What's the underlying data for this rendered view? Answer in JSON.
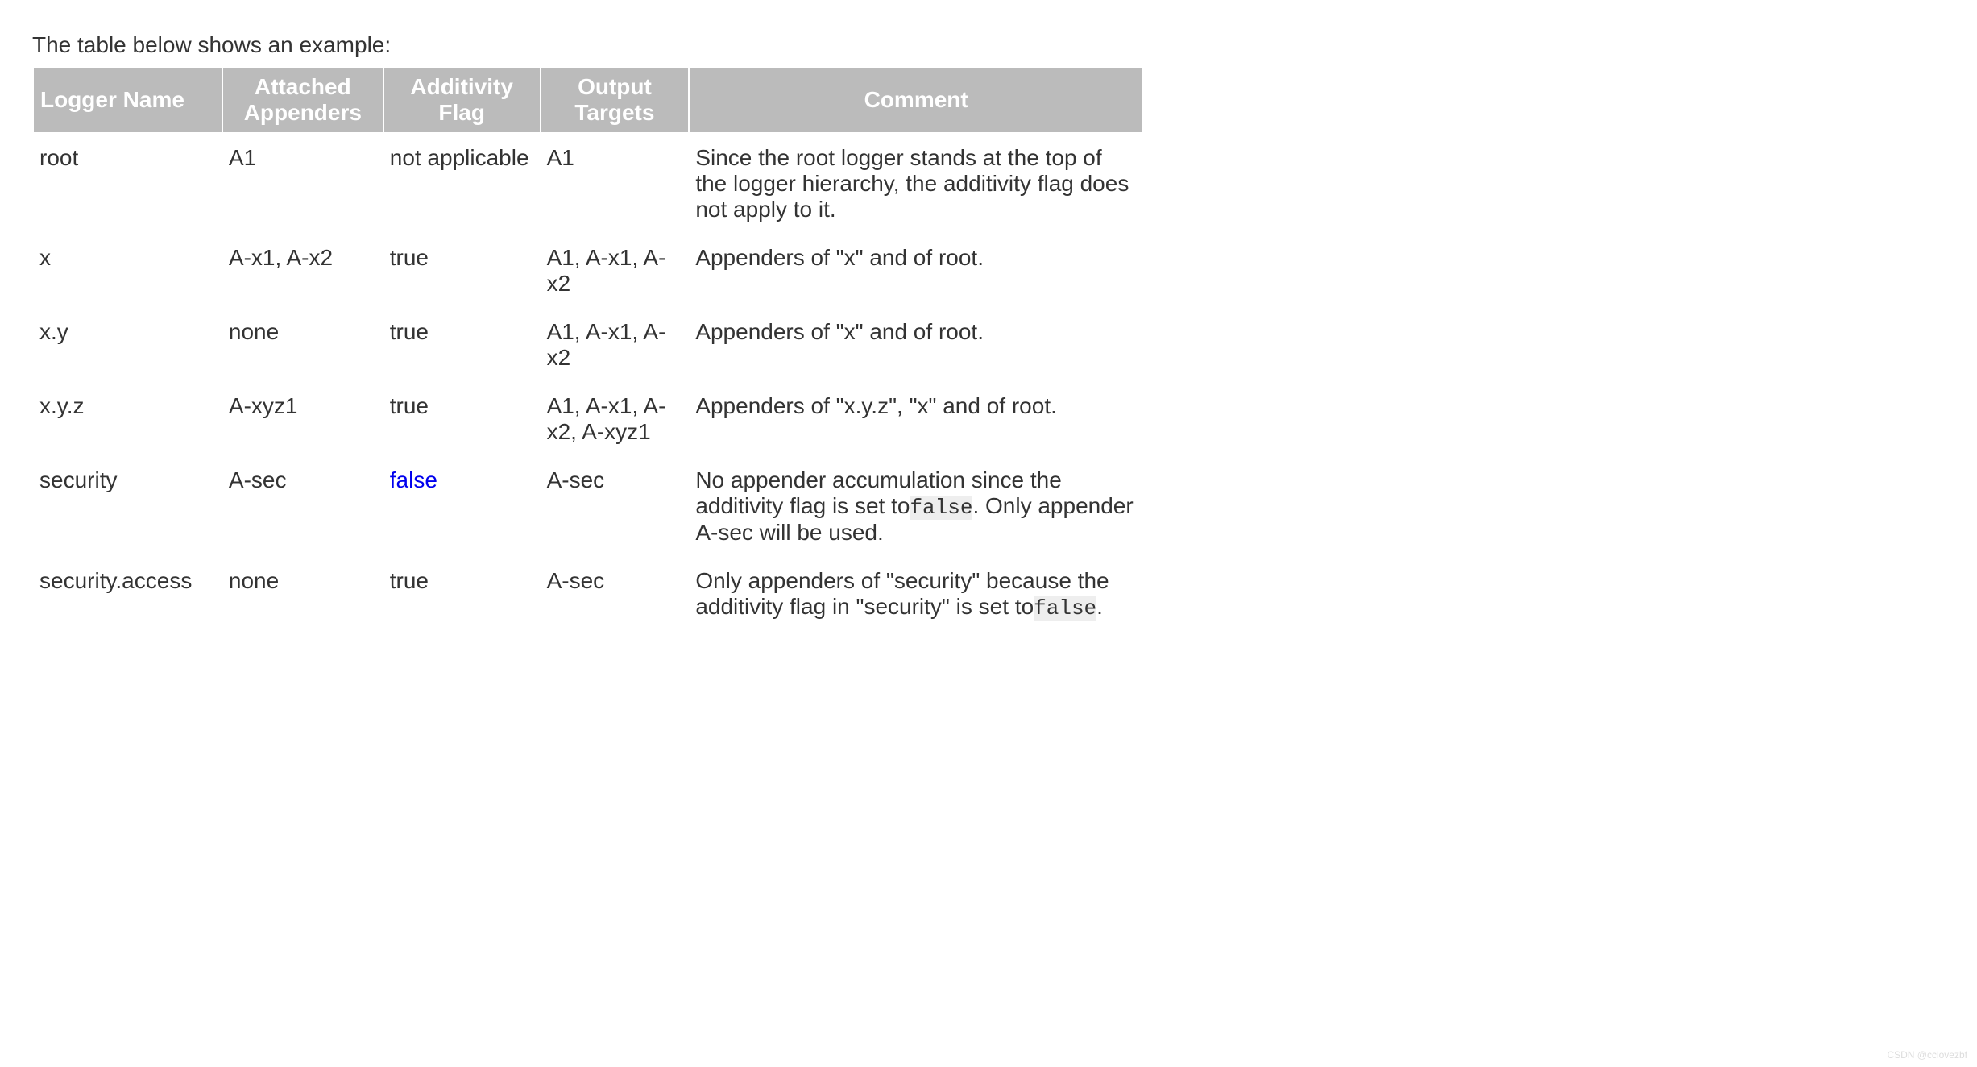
{
  "intro": "The table below shows an example:",
  "headers": {
    "logger": "Logger Name",
    "appenders": "Attached Appenders",
    "additivity": "Additivity Flag",
    "targets": "Output Targets",
    "comment": "Comment"
  },
  "rows": [
    {
      "logger": "root",
      "appenders": "A1",
      "additivity": "not applicable",
      "additivity_false": false,
      "targets": "A1",
      "comment_pre": "Since the root logger stands at the top of the logger hierarchy, the additivity flag does not apply to it.",
      "comment_code": "",
      "comment_post": ""
    },
    {
      "logger": "x",
      "appenders": "A-x1, A-x2",
      "additivity": "true",
      "additivity_false": false,
      "targets": "A1, A-x1, A-x2",
      "comment_pre": "Appenders of \"x\" and of root.",
      "comment_code": "",
      "comment_post": ""
    },
    {
      "logger": "x.y",
      "appenders": "none",
      "additivity": "true",
      "additivity_false": false,
      "targets": "A1, A-x1, A-x2",
      "comment_pre": "Appenders of \"x\" and of root.",
      "comment_code": "",
      "comment_post": ""
    },
    {
      "logger": "x.y.z",
      "appenders": "A-xyz1",
      "additivity": "true",
      "additivity_false": false,
      "targets": "A1, A-x1, A-x2, A-xyz1",
      "comment_pre": "Appenders of \"x.y.z\", \"x\" and of root.",
      "comment_code": "",
      "comment_post": ""
    },
    {
      "logger": "security",
      "appenders": "A-sec",
      "additivity": "false",
      "additivity_false": true,
      "targets": "A-sec",
      "comment_pre": "No appender accumulation since the additivity flag is set to",
      "comment_code": "false",
      "comment_post": ". Only appender A-sec will be used."
    },
    {
      "logger": "security.access",
      "appenders": "none",
      "additivity": "true",
      "additivity_false": false,
      "targets": "A-sec",
      "comment_pre": "Only appenders of \"security\" because the additivity flag in \"security\" is set to",
      "comment_code": "false",
      "comment_post": "."
    }
  ],
  "watermark": "CSDN @cclovezbf"
}
